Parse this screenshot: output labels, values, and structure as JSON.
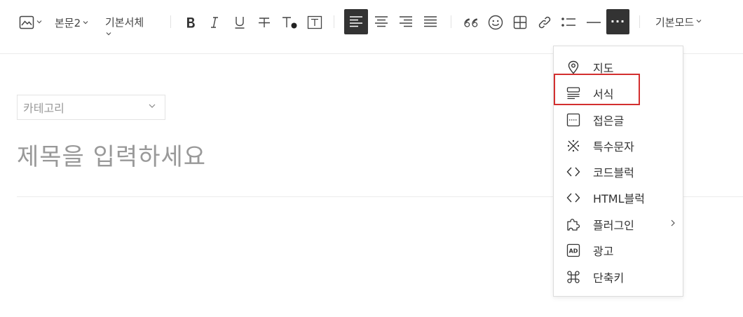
{
  "toolbar": {
    "paragraph_style": "본문2",
    "font_family": "기본서체",
    "more_label": "···",
    "mode": "기본모드"
  },
  "editor": {
    "category_placeholder": "카테고리",
    "title_placeholder": "제목을 입력하세요"
  },
  "more_menu": {
    "items": [
      {
        "label": "지도",
        "icon": "map-pin-icon"
      },
      {
        "label": "서식",
        "icon": "template-icon"
      },
      {
        "label": "접은글",
        "icon": "fold-icon"
      },
      {
        "label": "특수문자",
        "icon": "special-char-icon"
      },
      {
        "label": "코드블럭",
        "icon": "code-icon"
      },
      {
        "label": "HTML블럭",
        "icon": "html-code-icon"
      },
      {
        "label": "플러그인",
        "icon": "puzzle-icon",
        "has_submenu": true
      },
      {
        "label": "광고",
        "icon": "ad-icon"
      },
      {
        "label": "단축키",
        "icon": "command-icon"
      }
    ]
  },
  "colors": {
    "active_button_bg": "#333333",
    "highlight_border": "#d32f2f",
    "placeholder": "#999999"
  }
}
